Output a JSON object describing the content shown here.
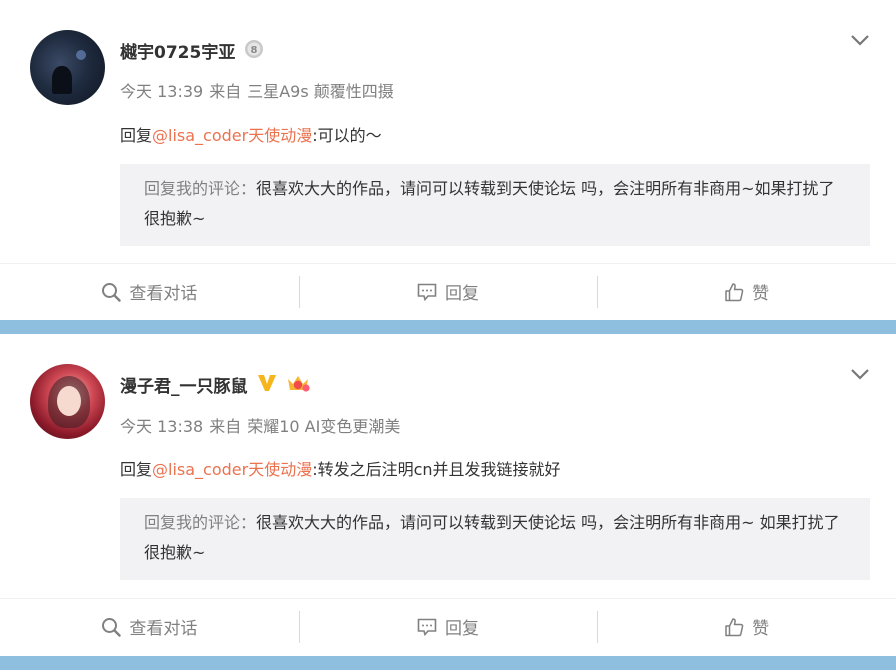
{
  "colors": {
    "background": "#8fbfdf",
    "mention": "#eb7350",
    "meta_gray": "#808080",
    "quote_bg": "#f2f2f5"
  },
  "posts": [
    {
      "username": "樾宇0725宇亚",
      "badges": [
        "medal-icon"
      ],
      "time": "今天 13:39",
      "source_prefix": "来自",
      "source": "三星A9s 颠覆性四摄",
      "reply_prefix": "回复",
      "mention": "@lisa_coder天使动漫",
      "reply_body": ":可以的～",
      "quote_label": "回复我的评论：",
      "quote_text": "很喜欢大大的作品，请问可以转载到天使论坛 吗，会注明所有非商用~如果打扰了很抱歉~",
      "actions": [
        "查看对话",
        "回复",
        "赞"
      ]
    },
    {
      "username": "漫子君_一只豚鼠",
      "badges": [
        "verified-v-icon",
        "vip-crown-icon"
      ],
      "time": "今天 13:38",
      "source_prefix": "来自",
      "source": "荣耀10 AI变色更潮美",
      "reply_prefix": "回复",
      "mention": "@lisa_coder天使动漫",
      "reply_body": ":转发之后注明cn并且发我链接就好",
      "quote_label": "回复我的评论：",
      "quote_text": "很喜欢大大的作品，请问可以转载到天使论坛  吗，会注明所有非商用~ 如果打扰了很抱歉~",
      "actions": [
        "查看对话",
        "回复",
        "赞"
      ]
    }
  ]
}
